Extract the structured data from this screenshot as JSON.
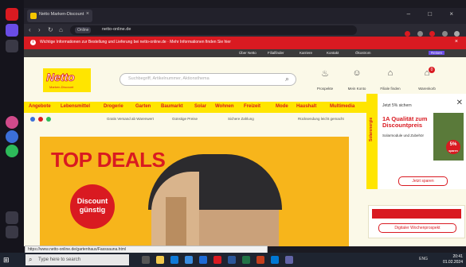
{
  "browser": {
    "tab_title": "Netto Marken-Discount",
    "address": "netto-online.de",
    "url_pill": "Online"
  },
  "info_bar": {
    "text": "Wichtige Informationen zur Bestellung und Lieferung bei netto-online.de · Mehr Informationen finden Sie hier"
  },
  "top_nav": [
    "Über Netto",
    "Filialfinder",
    "Karriere",
    "Kontakt",
    "Ökostrom",
    "Reisen"
  ],
  "logo": {
    "name": "Netto",
    "sub": "Marken-Discount"
  },
  "search": {
    "placeholder": "Suchbegriff, Artikelnummer, Aktionsthema"
  },
  "user_icons": [
    {
      "label": "Prospekte",
      "glyph": "♨"
    },
    {
      "label": "Mein Konto",
      "glyph": "☺"
    },
    {
      "label": "Filiale finden",
      "glyph": "⌂"
    },
    {
      "label": "Warenkorb",
      "glyph": "⌂",
      "badge": "0"
    }
  ],
  "categories": [
    "Angebote",
    "Lebensmittel",
    "Drogerie",
    "Garten",
    "Baumarkt",
    "Solar",
    "Wohnen",
    "Freizeit",
    "Mode",
    "Haushalt",
    "Multimedia"
  ],
  "usps": [
    "Gratis Versand ab Warenwert",
    "Günstige Preise",
    "Sichere Zahlung",
    "Rücksendung leicht gemacht"
  ],
  "hero": {
    "headline": "TOP DEALS",
    "badge_line1": "Discount",
    "badge_line2": "günstig"
  },
  "side_ad": {
    "tab_label": "Solarenergie",
    "header": "Jetzt 5% sichern",
    "title_line1": "1A Qualität zum",
    "title_line2": "Discountpreis",
    "subtitle": "Solarmodule und Zubehör",
    "percent": "5%",
    "percent_sub": "sparen",
    "button": "Jetzt sparen",
    "close": "✕"
  },
  "prospekt_box": {
    "link": "Digitaler Wochenprospekt"
  },
  "status_url": "https://www.netto-online.de/gartenhaus/Fasssauna.html",
  "taskbar": {
    "search_placeholder": "Type here to search",
    "tray": "ENG",
    "time": "20:41",
    "date": "01.02.2024"
  },
  "colors": {
    "netto_yellow": "#ffe500",
    "netto_red": "#d91a21",
    "hero_orange": "#f7b51b"
  }
}
